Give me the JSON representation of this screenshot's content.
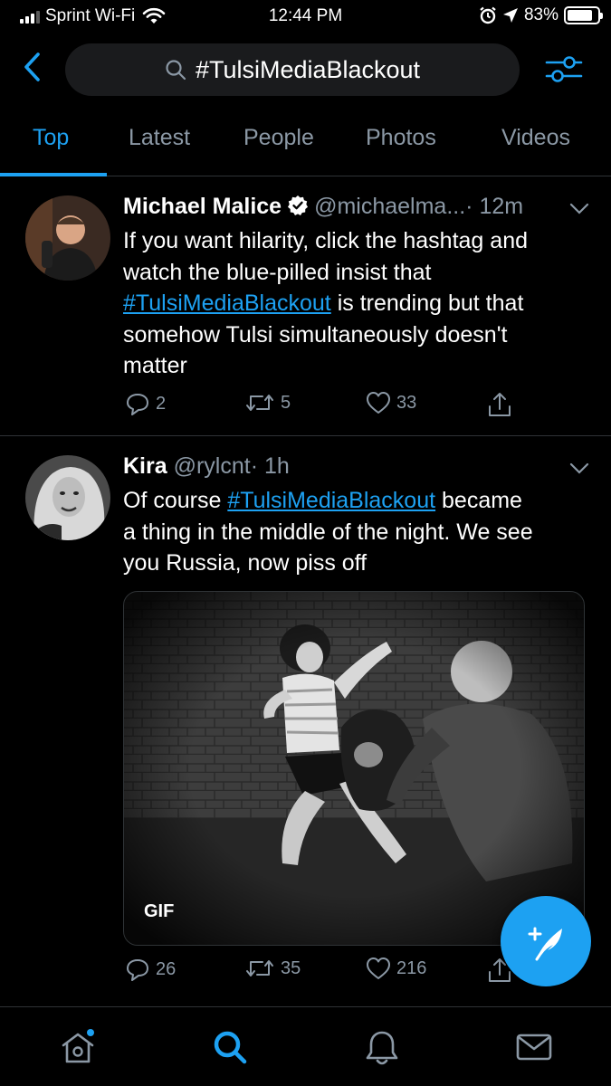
{
  "status_bar": {
    "carrier": "Sprint Wi-Fi",
    "time": "12:44 PM",
    "battery": "83%",
    "battery_level": 0.83
  },
  "search": {
    "query": "#TulsiMediaBlackout"
  },
  "tabs": [
    {
      "label": "Top",
      "active": true
    },
    {
      "label": "Latest",
      "active": false
    },
    {
      "label": "People",
      "active": false
    },
    {
      "label": "Photos",
      "active": false
    },
    {
      "label": "Videos",
      "active": false
    }
  ],
  "tweets": [
    {
      "name": "Michael Malice",
      "verified": true,
      "handle": "@michaelma...",
      "time": "· 12m",
      "text_lines": [
        "If you want hilarity, click the hashtag and",
        "watch the blue-pilled insist that"
      ],
      "hashtag": "#TulsiMediaBlackout",
      "text_after_hashtag": " is trending but that",
      "text_lines_end": [
        "somehow Tulsi simultaneously doesn't",
        "matter"
      ],
      "replies": "2",
      "retweets": "5",
      "likes": "33"
    },
    {
      "name": "Kira",
      "verified": false,
      "handle": "@rylcnt",
      "time": "· 1h",
      "text_before_hashtag": "Of course ",
      "hashtag": "#TulsiMediaBlackout",
      "text_after_hashtag": " became",
      "text_lines_end": [
        "a thing in the middle of the night. We see",
        "you Russia, now piss off"
      ],
      "media_badge": "GIF",
      "replies": "26",
      "retweets": "35",
      "likes": "216"
    }
  ],
  "colors": {
    "accent": "#1da1f2",
    "muted": "#8b98a5",
    "background": "#000000"
  },
  "icons": {
    "back": "chevron-left-icon",
    "search": "search-icon",
    "filter": "sliders-icon",
    "reply": "reply-icon",
    "retweet": "retweet-icon",
    "like": "heart-icon",
    "share": "share-icon",
    "compose": "compose-tweet-icon",
    "home": "home-icon",
    "explore": "search-icon",
    "notifications": "bell-icon",
    "messages": "mail-icon"
  }
}
